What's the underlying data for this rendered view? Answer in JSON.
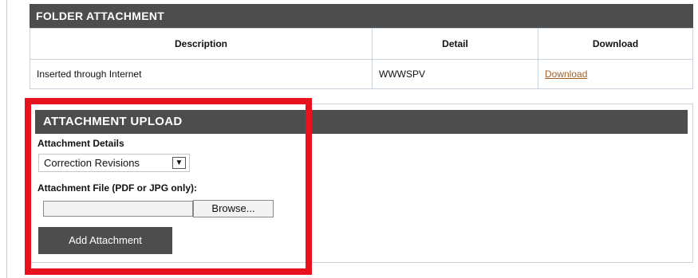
{
  "folder_attachment": {
    "title": "FOLDER ATTACHMENT",
    "columns": [
      "Description",
      "Detail",
      "Download"
    ],
    "rows": [
      {
        "description": "Inserted through Internet",
        "detail": "WWWSPV",
        "download": "Download"
      }
    ]
  },
  "attachment_upload": {
    "title": "ATTACHMENT UPLOAD",
    "details_label": "Attachment Details",
    "details_selected": "Correction Revisions",
    "file_label": "Attachment File (PDF or JPG only):",
    "file_value": "",
    "browse_label": "Browse...",
    "add_label": "Add Attachment"
  },
  "colors": {
    "header_bg": "#4d4d4d",
    "link": "#a0622d",
    "highlight": "#e8121e",
    "border": "#c9d3de"
  }
}
